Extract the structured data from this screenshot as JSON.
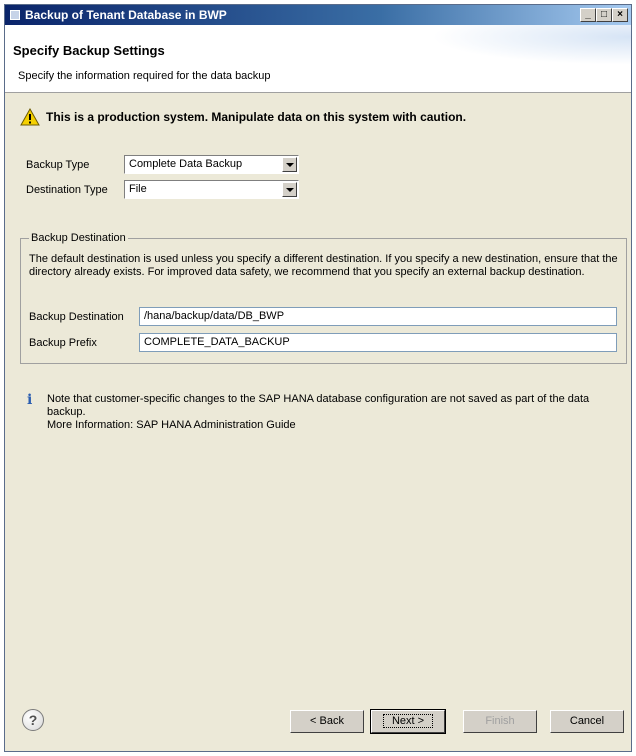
{
  "window": {
    "title": "Backup of Tenant Database in BWP"
  },
  "header": {
    "title": "Specify Backup Settings",
    "description": "Specify the information required for the data backup"
  },
  "warning": {
    "text": "This is a production system. Manipulate data on this system with caution."
  },
  "settings": {
    "backup_type_label": "Backup Type",
    "backup_type_value": "Complete Data Backup",
    "destination_type_label": "Destination Type",
    "destination_type_value": "File"
  },
  "destination": {
    "group_label": "Backup Destination",
    "description": "The default destination is used unless you specify a different destination. If you specify a new destination, ensure that the directory already exists. For improved data safety, we recommend that you specify an external backup destination.",
    "backup_destination_label": "Backup Destination",
    "backup_destination_value": "/hana/backup/data/DB_BWP",
    "backup_prefix_label": "Backup Prefix",
    "backup_prefix_value": "COMPLETE_DATA_BACKUP"
  },
  "note": {
    "line1": "Note that customer-specific changes to the SAP HANA database configuration are not saved as part of the data backup.",
    "line2": "More Information: SAP HANA Administration Guide"
  },
  "footer": {
    "help": "?",
    "back": "< Back",
    "next": "Next >",
    "finish": "Finish",
    "cancel": "Cancel"
  },
  "icons": {
    "warning": "warning-triangle-icon",
    "info": "info-icon",
    "help": "help-icon"
  }
}
